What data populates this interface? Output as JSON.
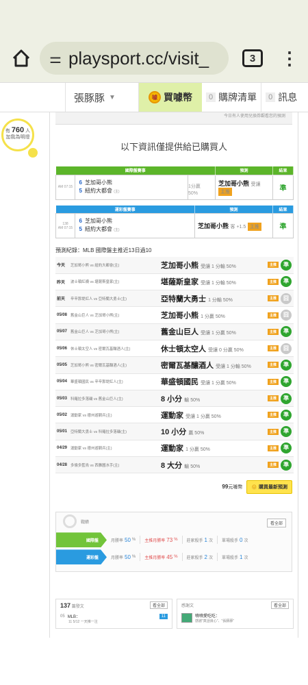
{
  "browser": {
    "url": "playsport.cc/visit_",
    "tab_count": "3"
  },
  "nav": {
    "user": "張豚豚",
    "buy_label": "買噱幣",
    "coin_text": "噱",
    "items": [
      {
        "count": "0",
        "label": "購牌清單"
      },
      {
        "count": "0",
        "label": "訊息"
      }
    ]
  },
  "hint": {
    "prefix": "有",
    "count": "760",
    "suffix": "人",
    "line2": "加我為明燈"
  },
  "top_note": "今日有人使用兌換券觀看您的預測",
  "notice": "以下資訊僅提供給已購買人",
  "intl_table": {
    "headers": [
      "國際盤賽事",
      "預測",
      "結果"
    ],
    "time": "AM 07:15",
    "team1_no": "6",
    "team1": "芝加哥小熊",
    "team2_no": "5",
    "team2": "紐約大都會",
    "host": "(主)",
    "line": "1分贏",
    "line_pct": "50%",
    "pick": "芝加哥小熊",
    "pick_note": "受讓",
    "tag": "主推",
    "result": "準"
  },
  "tw_table": {
    "headers": [
      "運彩盤賽事",
      "預測",
      "結果"
    ],
    "game_no": "138",
    "time": "AM 07:15",
    "team1_no": "6",
    "team1": "芝加哥小熊",
    "team2_no": "5",
    "team2": "紐約大都會",
    "host": "(主)",
    "pick": "芝加哥小熊",
    "pick_note": "客 +1.5",
    "tag": "主推",
    "result": "準"
  },
  "records_title": "預測紀錄：MLB 國際盤主推近13日過10",
  "records": [
    {
      "date": "今天",
      "match": "芝加哥小熊 vs 紐約大都會(主)",
      "pick": "芝加哥小熊",
      "note": "受讓 1 分輸 50%",
      "tag": "主推",
      "result": "準",
      "win": true
    },
    {
      "date": "昨天",
      "match": "波士頓紅襪 vs 堪薩斯皇家(主)",
      "pick": "堪薩斯皇家",
      "note": "受讓 1 分輸 50%",
      "tag": "主推",
      "result": "準",
      "win": true
    },
    {
      "date": "前天",
      "match": "辛辛那堤紅人 vs 亞特蘭大勇士(主)",
      "pick": "亞特蘭大勇士",
      "note": "1 分輸 50%",
      "tag": "主推",
      "result": "囧",
      "win": false
    },
    {
      "date": "05/08",
      "match": "舊金山巨人 vs 芝加哥小熊(主)",
      "pick": "芝加哥小熊",
      "note": "1 分贏 50%",
      "tag": "主推",
      "result": "囧",
      "win": false
    },
    {
      "date": "05/07",
      "match": "舊金山巨人 vs 芝加哥小熊(主)",
      "pick": "舊金山巨人",
      "note": "受讓 1 分贏 50%",
      "tag": "主推",
      "result": "準",
      "win": true
    },
    {
      "date": "05/06",
      "match": "休士頓太空人 vs 密爾瓦基釀酒人(主)",
      "pick": "休士頓太空人",
      "note": "受讓 0 分贏 50%",
      "tag": "主推",
      "result": "囧",
      "win": false
    },
    {
      "date": "05/05",
      "match": "芝加哥小熊 vs 密爾瓦基釀酒人(主)",
      "pick": "密爾瓦基釀酒人",
      "note": "受讓 1 分輸 50%",
      "tag": "主推",
      "result": "準",
      "win": true
    },
    {
      "date": "05/04",
      "match": "華盛頓國民 vs 辛辛那堤紅人(主)",
      "pick": "華盛頓國民",
      "note": "受讓 1 分贏 50%",
      "tag": "主推",
      "result": "準",
      "win": true
    },
    {
      "date": "05/03",
      "match": "科羅拉多落磯 vs 舊金山巨人(主)",
      "pick": "8 小分",
      "note": "輸 50%",
      "tag": "主推",
      "result": "準",
      "win": true
    },
    {
      "date": "05/02",
      "match": "運動家 vs 德州遊騎兵(主)",
      "pick": "運動家",
      "note": "受讓 1 分贏 50%",
      "tag": "主推",
      "result": "準",
      "win": true
    },
    {
      "date": "05/01",
      "match": "亞特蘭大勇士 vs 科羅拉多落磯(主)",
      "pick": "10 小分",
      "note": "贏 50%",
      "tag": "主推",
      "result": "準",
      "win": true
    },
    {
      "date": "04/29",
      "match": "運動家 vs 德州遊騎兵(主)",
      "pick": "運動家",
      "note": "1 分贏 50%",
      "tag": "主推",
      "result": "準",
      "win": true
    },
    {
      "date": "04/28",
      "match": "多倫多藍鳥 vs 西雅圖水手(主)",
      "pick": "8 大分",
      "note": "輸 50%",
      "tag": "主推",
      "result": "準",
      "win": true
    }
  ],
  "buy": {
    "price": "99",
    "unit": "元噱幣",
    "button": "購買最新預測"
  },
  "stats": {
    "title": "戰績",
    "all": "看全部",
    "rows": [
      {
        "label": "國際盤",
        "color": "#72c43a",
        "c1_label": "月勝率",
        "c1": "50",
        "c1_unit": "%",
        "c2_label": "主推月勝率",
        "c2": "73",
        "c2_unit": "%",
        "c3_label": "莊家殺手",
        "c3": "1",
        "c3_unit": "次",
        "c4_label": "單場殺手",
        "c4": "0",
        "c4_unit": "次"
      },
      {
        "label": "運彩盤",
        "color": "#2a9be0",
        "c1_label": "月勝率",
        "c1": "50",
        "c1_unit": "%",
        "c2_label": "主推月勝率",
        "c2": "45",
        "c2_unit": "%",
        "c3_label": "莊家殺手",
        "c3": "2",
        "c3_unit": "次",
        "c4_label": "單場殺手",
        "c4": "1",
        "c4_unit": "次"
      }
    ]
  },
  "posts": {
    "count": "137",
    "label": "篇發文",
    "all": "看全部",
    "item_no": "05",
    "item_title": "MLB：",
    "item_date": "11 5/12 一天推一注",
    "badge": "11"
  },
  "thanks": {
    "label": "感謝文",
    "all": "看全部",
    "title": "噴噴愛吃吃：",
    "text": "感謝\"真話良心\"、\"張豚豚\""
  }
}
